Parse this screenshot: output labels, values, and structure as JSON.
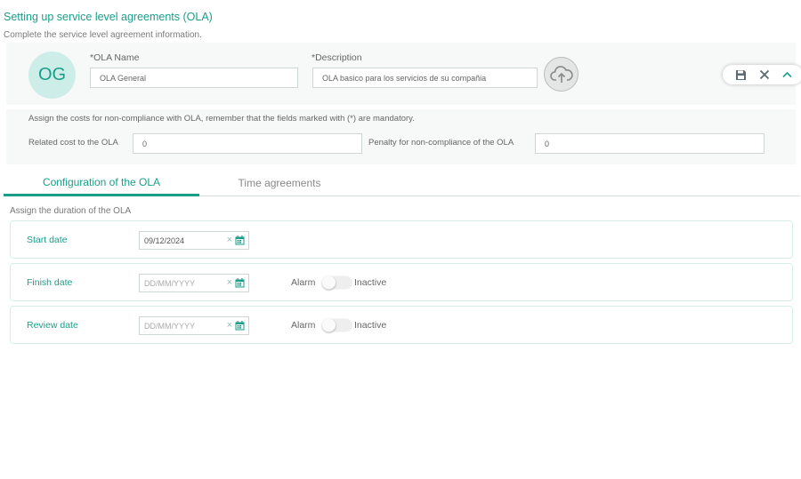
{
  "header": {
    "title": "Setting up service level agreements (OLA)",
    "subtitle": "Complete the service level agreement information."
  },
  "ola": {
    "avatar_initials": "OG",
    "name_label": "*OLA Name",
    "name_value": "OLA General",
    "description_label": "*Description",
    "description_value": "OLA basico para los servicios de su compañia",
    "upload_icon": "cloud-upload-icon"
  },
  "actions": {
    "save_icon": "save-icon",
    "close_icon": "close-icon",
    "collapse_icon": "chevron-up-icon"
  },
  "costs": {
    "note": "Assign the costs for non-compliance with OLA, remember that the fields marked with (*) are mandatory.",
    "related_cost_label": "Related cost to the OLA",
    "related_cost_value": "0",
    "penalty_label": "Penalty for non-compliance of the OLA",
    "penalty_value": "0"
  },
  "tabs": [
    {
      "label": "Configuration of the OLA",
      "active": true
    },
    {
      "label": "Time agreements",
      "active": false
    }
  ],
  "duration": {
    "label": "Assign the duration of the OLA",
    "rows": [
      {
        "label": "Start date",
        "value": "09/12/2024",
        "placeholder": ""
      },
      {
        "label": "Finish date",
        "value": "",
        "placeholder": "DD/MM/YYYY",
        "alarm_label": "Alarm",
        "alarm_state": "Inactive"
      },
      {
        "label": "Review date",
        "value": "",
        "placeholder": "DD/MM/YYYY",
        "alarm_label": "Alarm",
        "alarm_state": "Inactive"
      }
    ]
  },
  "colors": {
    "accent": "#1a9e8a",
    "avatar_bg": "#cdeee8",
    "card_bg": "#f7f8f8"
  }
}
